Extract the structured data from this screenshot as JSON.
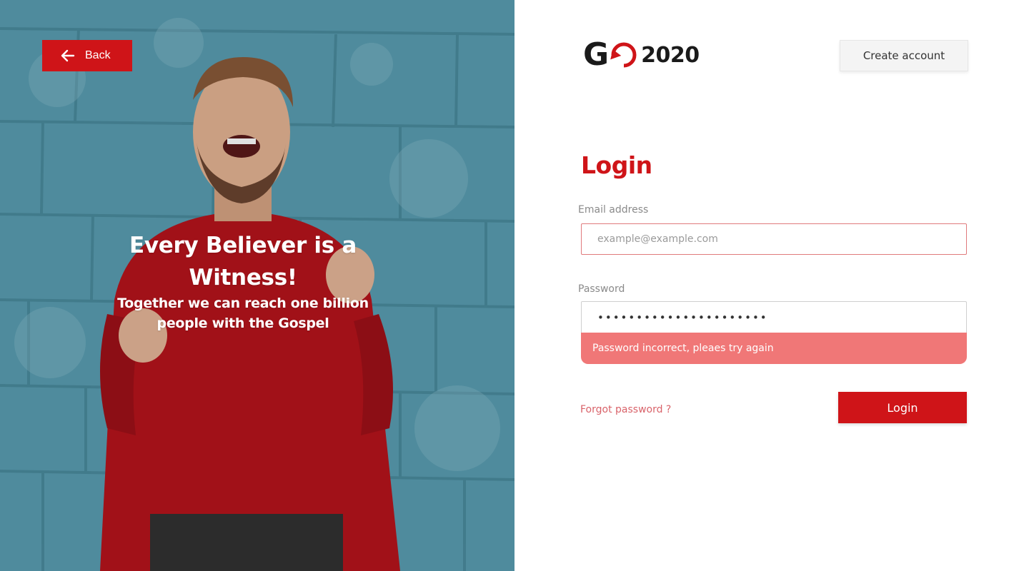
{
  "hero": {
    "back_label": "Back",
    "title": "Every Believer is a Witness!",
    "subtitle": "Together we can reach one billion people with the Gospel"
  },
  "logo": {
    "g_text": "G",
    "year": "2020",
    "icon": "go-2020-logo"
  },
  "header": {
    "create_account_label": "Create account"
  },
  "form": {
    "title": "Login",
    "email_label": "Email address",
    "email_placeholder": "example@example.com",
    "email_value": "",
    "password_label": "Password",
    "password_value": "••••••••••••••••••••••",
    "error_message": "Password incorrect, pleaes try again",
    "forgot_label": "Forgot password ?",
    "submit_label": "Login"
  },
  "colors": {
    "brand_red": "#cf1418",
    "error_bg": "#f07777",
    "hero_wall": "#5fa3b6"
  }
}
